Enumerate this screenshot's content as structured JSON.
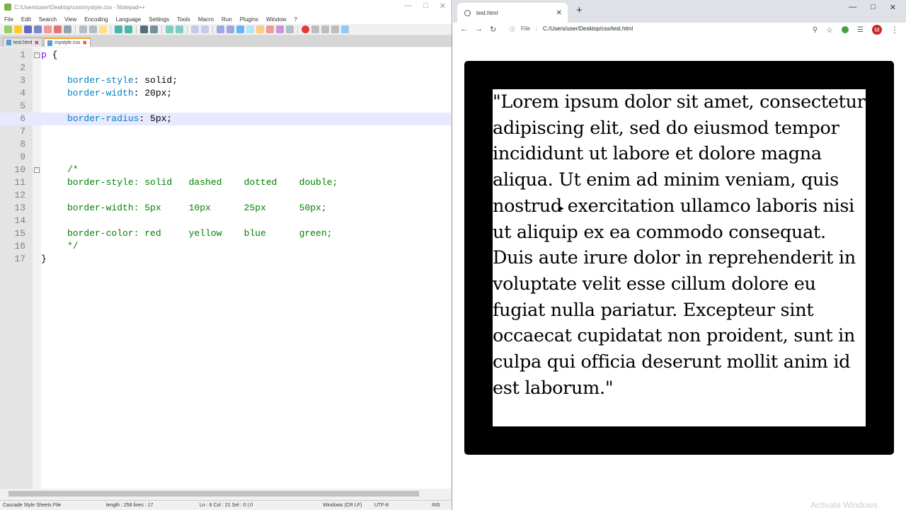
{
  "notepad": {
    "title": "C:\\Users\\user\\Desktop\\css\\mystyle.css - Notepad++",
    "menu": [
      "File",
      "Edit",
      "Search",
      "View",
      "Encoding",
      "Language",
      "Settings",
      "Tools",
      "Macro",
      "Run",
      "Plugins",
      "Window",
      "?"
    ],
    "tabs": [
      {
        "label": "test.html",
        "active": false
      },
      {
        "label": "mystyle.css",
        "active": true
      }
    ],
    "lines": [
      {
        "n": "1",
        "parts": [
          {
            "t": "p",
            "c": "sel"
          },
          {
            "t": " {",
            "c": "brace"
          }
        ],
        "offset": "sel"
      },
      {
        "n": "2",
        "parts": []
      },
      {
        "n": "3",
        "parts": [
          {
            "t": "border-style",
            "c": "prop"
          },
          {
            "t": ": solid;",
            "c": "val"
          }
        ]
      },
      {
        "n": "4",
        "parts": [
          {
            "t": "border-width",
            "c": "prop"
          },
          {
            "t": ": 20px;",
            "c": "val"
          }
        ]
      },
      {
        "n": "5",
        "parts": []
      },
      {
        "n": "6",
        "parts": [
          {
            "t": "border-radius",
            "c": "prop"
          },
          {
            "t": ": 5px;",
            "c": "val"
          }
        ],
        "current": true
      },
      {
        "n": "7",
        "parts": []
      },
      {
        "n": "8",
        "parts": []
      },
      {
        "n": "9",
        "parts": []
      },
      {
        "n": "10",
        "parts": [
          {
            "t": "/*",
            "c": "cmt"
          }
        ]
      },
      {
        "n": "11",
        "parts": [
          {
            "t": "border-style: solid   dashed    dotted    double;",
            "c": "cmt"
          }
        ]
      },
      {
        "n": "12",
        "parts": []
      },
      {
        "n": "13",
        "parts": [
          {
            "t": "border-width: 5px     10px      25px      50px;",
            "c": "cmt"
          }
        ]
      },
      {
        "n": "14",
        "parts": []
      },
      {
        "n": "15",
        "parts": [
          {
            "t": "border-color: red     yellow    blue      green;",
            "c": "cmt"
          }
        ]
      },
      {
        "n": "16",
        "parts": [
          {
            "t": "*/",
            "c": "cmt"
          }
        ]
      },
      {
        "n": "17",
        "parts": [
          {
            "t": "}",
            "c": "brace"
          }
        ],
        "offset": "sel"
      }
    ],
    "status": {
      "filetype": "Cascade Style Sheets File",
      "length": "length : 258    lines : 17",
      "position": "Ln : 6    Col : 21    Sel : 0 | 0",
      "eol": "Windows (CR LF)",
      "encoding": "UTF-8",
      "mode": "INS"
    }
  },
  "browser": {
    "tab_title": "test.html",
    "secure_label": "File",
    "url": "C:/Users/user/Desktop/css/test.html",
    "avatar_letter": "M",
    "paragraph": "\"Lorem ipsum dolor sit amet, consectetur adipiscing elit, sed do eiusmod tempor incididunt ut labore et dolore magna aliqua. Ut enim ad minim veniam, quis nostrud exercitation ullamco laboris nisi ut aliquip ex ea commodo consequat. Duis aute irure dolor in reprehenderit in voluptate velit esse cillum dolore eu fugiat nulla pariatur. Excepteur sint occaecat cupidatat non proident, sunt in culpa qui officia deserunt mollit anim id est laborum.\"",
    "watermark": "Activate Windows"
  }
}
